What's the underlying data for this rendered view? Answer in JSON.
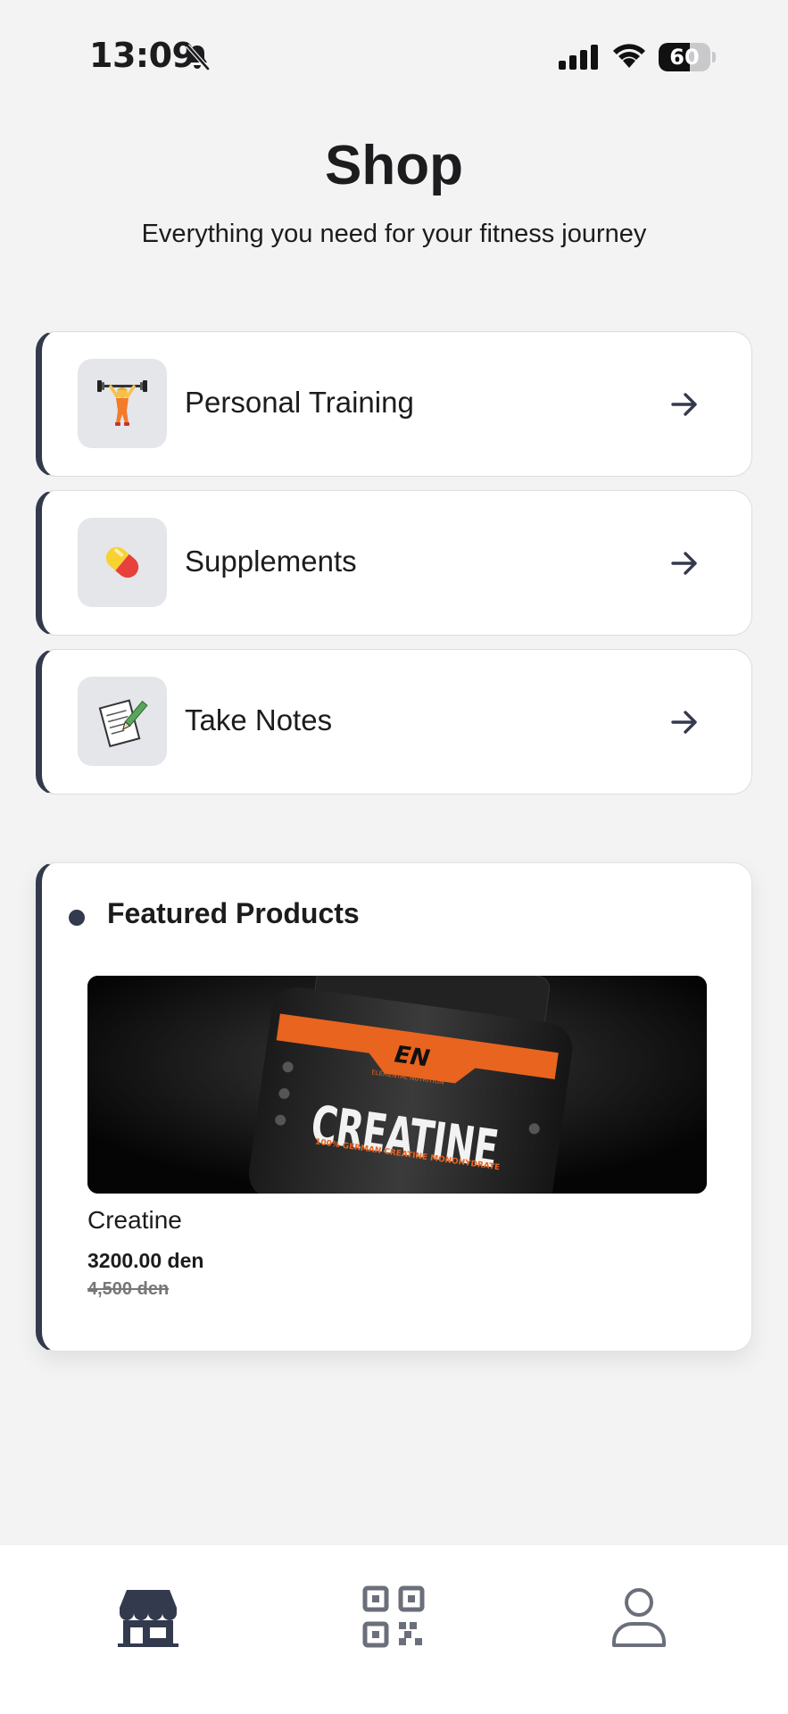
{
  "status_bar": {
    "time": "13:09",
    "battery": "60",
    "battery_level": 0.6
  },
  "header": {
    "title": "Shop",
    "subtitle": "Everything you need for your fitness journey"
  },
  "menu": [
    {
      "label": "Personal Training",
      "icon": "weightlifter-icon"
    },
    {
      "label": "Supplements",
      "icon": "pill-icon"
    },
    {
      "label": "Take Notes",
      "icon": "memo-icon"
    }
  ],
  "featured": {
    "title": "Featured Products",
    "products": [
      {
        "name": "Creatine",
        "price": "3200.00 den",
        "old_price": "4,500 den",
        "image_text": {
          "brand": "EN",
          "brand_full": "ELEMENTAL NUTRITION",
          "product": "CREATINE",
          "tagline": "100% GERMAN CREATINE MONOHYDRATE"
        }
      }
    ]
  },
  "bottom_nav": {
    "items": [
      {
        "name": "shop",
        "icon": "storefront-icon",
        "active": true
      },
      {
        "name": "qr",
        "icon": "qr-code-icon",
        "active": false
      },
      {
        "name": "profile",
        "icon": "user-icon",
        "active": false
      }
    ]
  },
  "colors": {
    "background": "#f3f3f4",
    "accent": "#333a4d",
    "card": "#ffffff",
    "icon_box": "#e4e6ea",
    "nav_inactive": "#6b6f7a"
  }
}
